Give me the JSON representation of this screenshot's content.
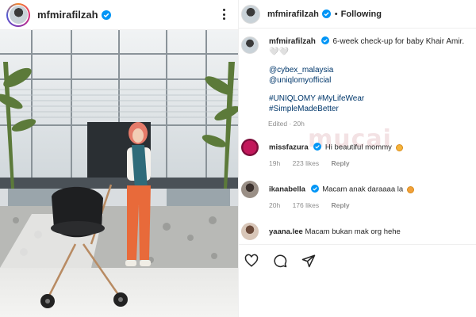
{
  "post": {
    "username": "mfmirafilzah"
  },
  "panel": {
    "username": "mfmirafilzah",
    "dot": "•",
    "follow_state": "Following"
  },
  "caption": {
    "username": "mfmirafilzah",
    "text": "6-week check-up for baby Khair Amir. 🤍🤍",
    "mentions": [
      "@cybex_malaysia",
      "@uniqlomyofficial"
    ],
    "hashtags_line1": "#UNIQLOMY #MyLifeWear",
    "hashtags_line2": "#SimpleMadeBetter",
    "edited": "Edited · 20h"
  },
  "watermark": "mucai",
  "comments": [
    {
      "username": "missfazura",
      "text": "Hi beautiful mommy",
      "time": "19h",
      "likes": "223 likes",
      "reply": "Reply"
    },
    {
      "username": "ikanabella",
      "text": "Macam anak daraaaa la",
      "time": "20h",
      "likes": "176 likes",
      "reply": "Reply"
    },
    {
      "username": "yaana.lee",
      "text": "Macam bukan mak org hehe"
    }
  ],
  "colors": {
    "verified": "#0095f6",
    "link": "#00376b",
    "muted": "#8e8e8e"
  },
  "icons": [
    "heart-icon",
    "comment-icon",
    "share-icon"
  ]
}
